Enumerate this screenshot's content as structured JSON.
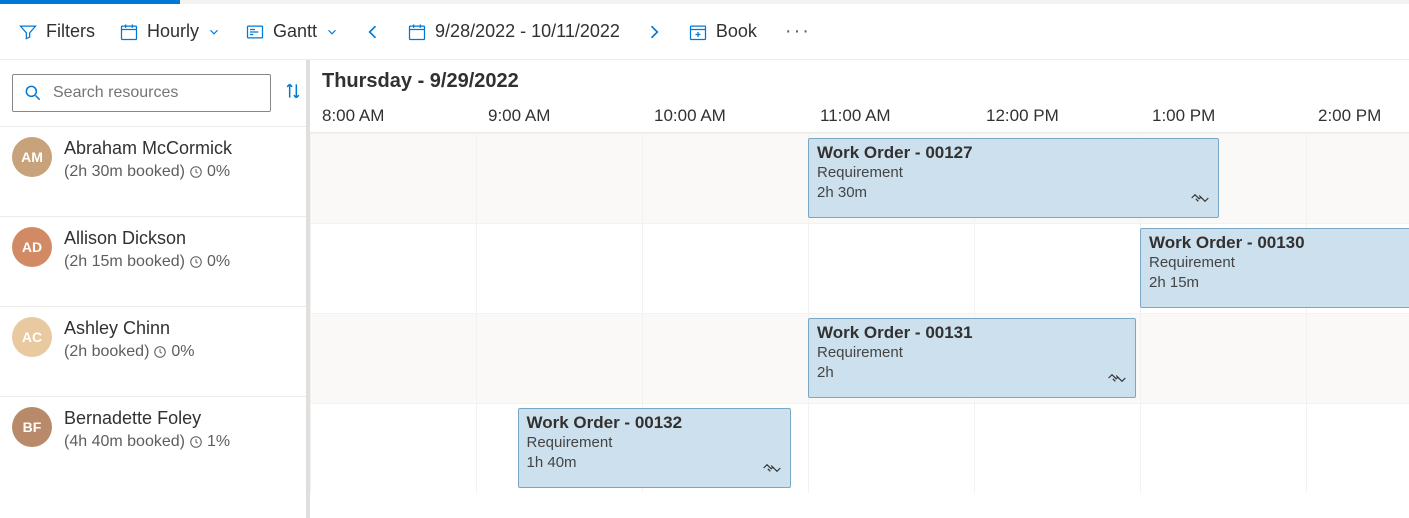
{
  "toolbar": {
    "filters": "Filters",
    "view_mode": "Hourly",
    "layout": "Gantt",
    "date_range": "9/28/2022 - 10/11/2022",
    "book": "Book"
  },
  "search": {
    "placeholder": "Search resources"
  },
  "date_header": "Thursday - 9/29/2022",
  "time_slots": [
    "8:00 AM",
    "9:00 AM",
    "10:00 AM",
    "11:00 AM",
    "12:00 PM",
    "1:00 PM",
    "2:00 PM"
  ],
  "resources": [
    {
      "name": "Abraham McCormick",
      "booked": "(2h 30m booked)",
      "util": "0%",
      "avatar_bg": "#c8a27a",
      "initials": "AM"
    },
    {
      "name": "Allison Dickson",
      "booked": "(2h 15m booked)",
      "util": "0%",
      "avatar_bg": "#d28a64",
      "initials": "AD"
    },
    {
      "name": "Ashley Chinn",
      "booked": "(2h booked)",
      "util": "0%",
      "avatar_bg": "#e8c9a0",
      "initials": "AC"
    },
    {
      "name": "Bernadette Foley",
      "booked": "(4h 40m booked)",
      "util": "1%",
      "avatar_bg": "#b88a6a",
      "initials": "BF"
    }
  ],
  "bookings": [
    {
      "row": 0,
      "title": "Work Order - 00127",
      "subtitle": "Requirement",
      "duration": "2h 30m",
      "start_hour": 3.0,
      "hours": 2.5,
      "handshake": true
    },
    {
      "row": 1,
      "title": "Work Order - 00130",
      "subtitle": "Requirement",
      "duration": "2h 15m",
      "start_hour": 5.0,
      "hours": 2.25,
      "handshake": false
    },
    {
      "row": 2,
      "title": "Work Order - 00131",
      "subtitle": "Requirement",
      "duration": "2h",
      "start_hour": 3.0,
      "hours": 2.0,
      "handshake": true
    },
    {
      "row": 3,
      "title": "Work Order - 00132",
      "subtitle": "Requirement",
      "duration": "1h 40m",
      "start_hour": 1.25,
      "hours": 1.67,
      "handshake": true
    }
  ]
}
